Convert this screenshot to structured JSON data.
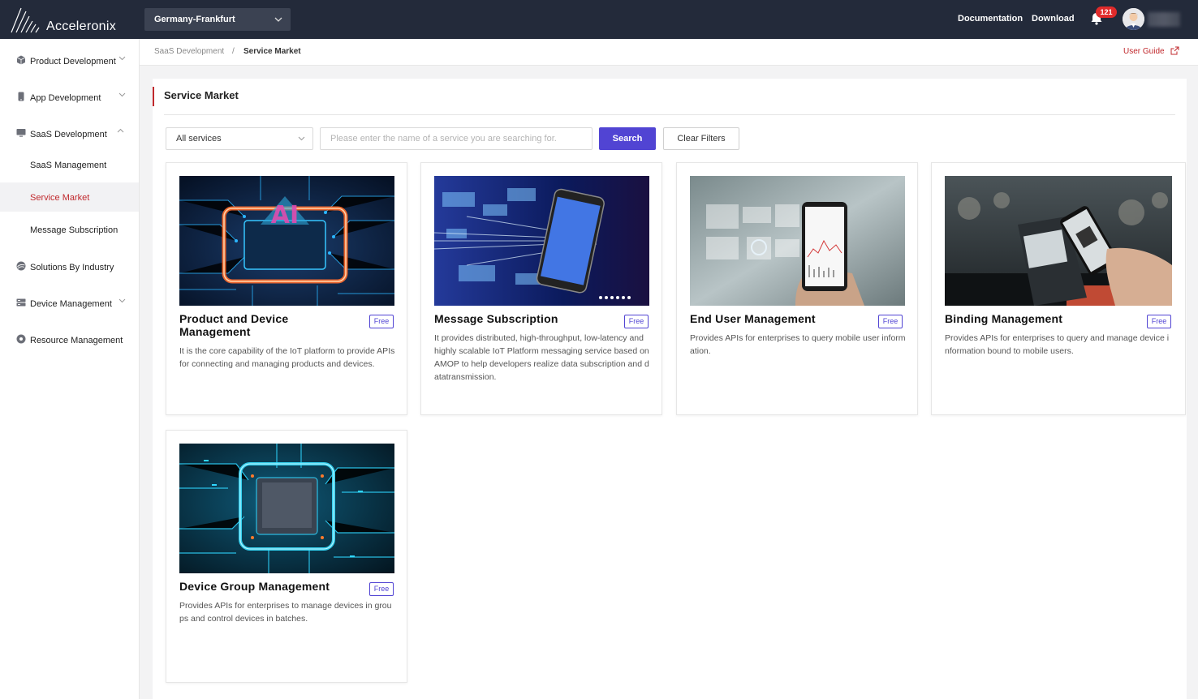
{
  "header": {
    "brand": "Acceleronix",
    "region": "Germany-Frankfurt",
    "links": {
      "documentation": "Documentation",
      "download": "Download"
    },
    "notification_count": "121"
  },
  "sidebar": {
    "items": [
      {
        "label": "Product Development",
        "icon": "cube-icon",
        "expanded": false
      },
      {
        "label": "App Development",
        "icon": "phone-icon",
        "expanded": false
      },
      {
        "label": "SaaS Development",
        "icon": "monitor-icon",
        "expanded": true
      },
      {
        "label": "Solutions By Industry",
        "icon": "layers-icon"
      },
      {
        "label": "Device Management",
        "icon": "server-icon",
        "expanded": false
      },
      {
        "label": "Resource Management",
        "icon": "gear-icon"
      }
    ],
    "subitems": [
      {
        "label": "SaaS Management",
        "active": false
      },
      {
        "label": "Service Market",
        "active": true
      },
      {
        "label": "Message Subscription",
        "active": false
      }
    ]
  },
  "breadcrumb": {
    "parent": "SaaS Development",
    "separator": "/",
    "current": "Service Market",
    "user_guide": "User Guide"
  },
  "page": {
    "title": "Service Market",
    "filter_select": "All services",
    "search_placeholder": "Please enter the name of a service you are searching for.",
    "search_button": "Search",
    "clear_button": "Clear Filters"
  },
  "cards": [
    {
      "title": "Product and Device Management",
      "badge": "Free",
      "description": "It is the core capability of the IoT platform to provide APIs for connecting and managing products and devices.",
      "image": "ai-chip-orange-image"
    },
    {
      "title": "Message Subscription",
      "badge": "Free",
      "description": "It provides distributed, high-throughput, low-latency and highly scalable IoT Platform messaging service based on AMOP to help developers realize data subscription and datatransmission.",
      "image": "phone-data-stream-image"
    },
    {
      "title": "End User Management",
      "badge": "Free",
      "description": "Provides APIs for enterprises to query mobile user information.",
      "image": "hand-phone-charts-image"
    },
    {
      "title": "Binding Management",
      "badge": "Free",
      "description": "Provides APIs for enterprises to query and manage device information bound to mobile users.",
      "image": "phone-payment-terminal-image"
    },
    {
      "title": "Device Group Management",
      "badge": "Free",
      "description": "Provides APIs for enterprises to manage devices in groups and control devices in batches.",
      "image": "blue-chip-circuit-image"
    }
  ],
  "colors": {
    "topbar": "#232a3a",
    "accent_red": "#c0282c",
    "primary_purple": "#5144d3"
  }
}
